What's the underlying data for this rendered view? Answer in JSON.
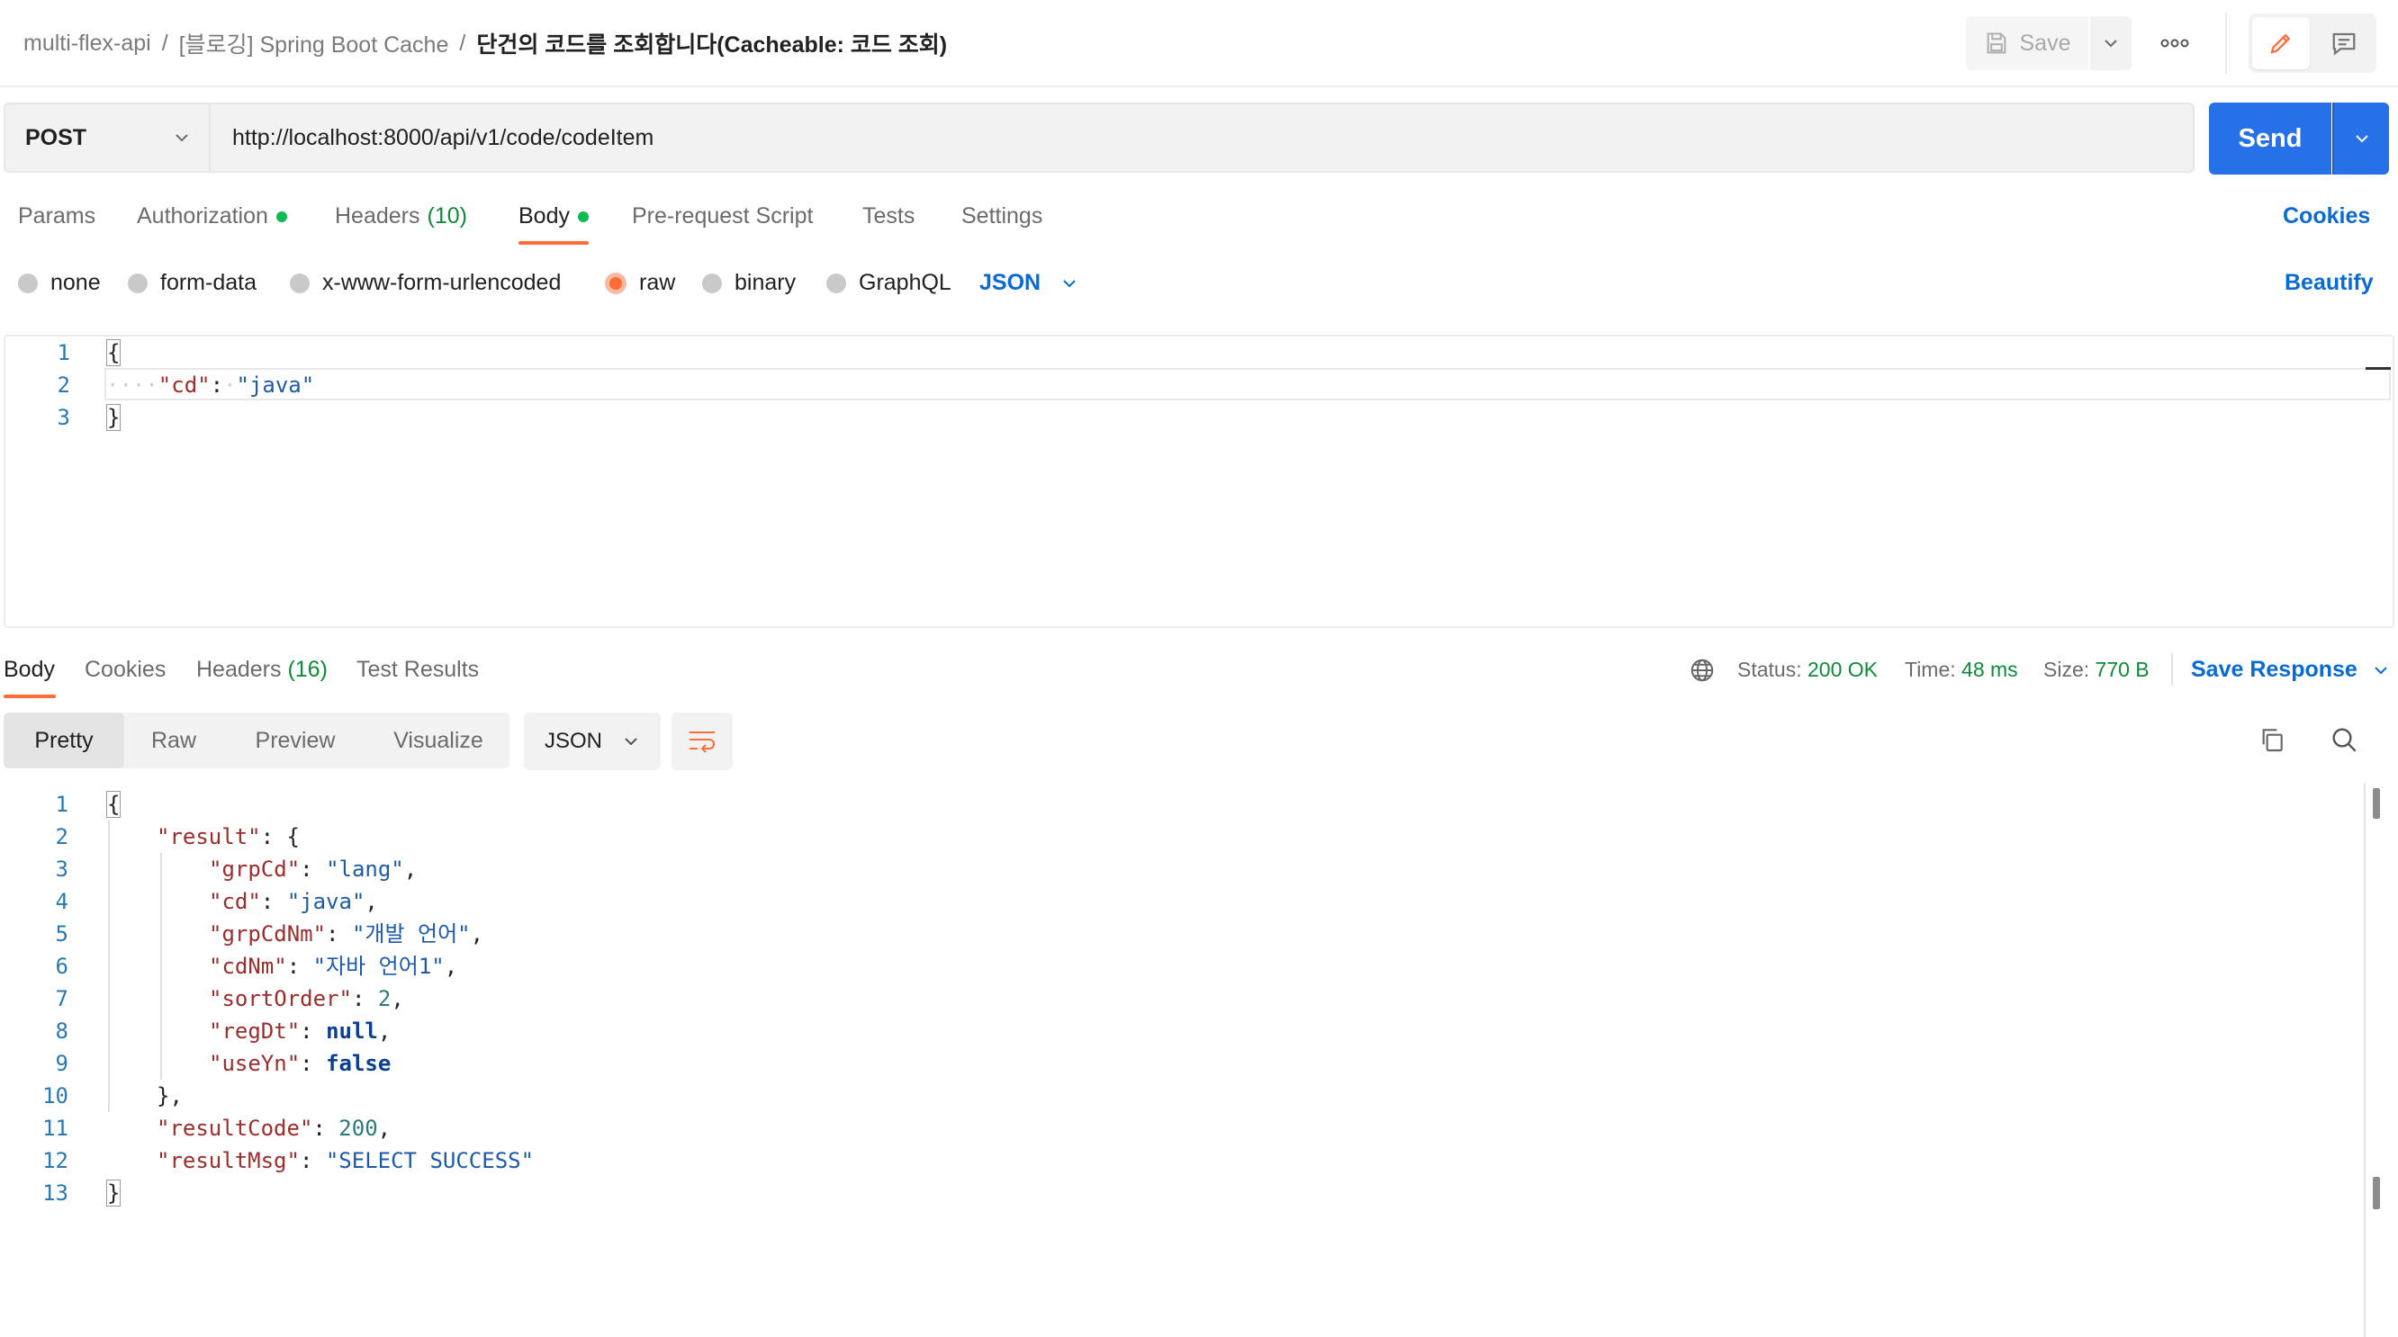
{
  "breadcrumb": {
    "workspace": "multi-flex-api",
    "collection": "[블로깅] Spring Boot Cache",
    "request": "단건의 코드를 조회합니다(Cacheable: 코드 조회)",
    "separator": "/"
  },
  "header": {
    "save_label": "Save"
  },
  "request": {
    "method": "POST",
    "url": "http://localhost:8000/api/v1/code/codeItem",
    "send_label": "Send"
  },
  "request_tabs": {
    "params": "Params",
    "authorization": "Authorization",
    "headers": "Headers",
    "headers_count": "(10)",
    "body": "Body",
    "prerequest": "Pre-request Script",
    "tests": "Tests",
    "settings": "Settings",
    "cookies": "Cookies"
  },
  "body_types": {
    "none": "none",
    "form_data": "form-data",
    "urlencoded": "x-www-form-urlencoded",
    "raw": "raw",
    "binary": "binary",
    "graphql": "GraphQL",
    "language": "JSON",
    "beautify": "Beautify",
    "selected": "raw"
  },
  "request_body": {
    "line_numbers": [
      "1",
      "2",
      "3"
    ],
    "open": "{",
    "indent": "····",
    "key": "\"cd\"",
    "colon": ":",
    "value": "\"java\"",
    "close": "}"
  },
  "response_tabs": {
    "body": "Body",
    "cookies": "Cookies",
    "headers": "Headers",
    "headers_count": "(16)",
    "test_results": "Test Results"
  },
  "response_status": {
    "status_label": "Status:",
    "status_value": "200 OK",
    "time_label": "Time:",
    "time_value": "48 ms",
    "size_label": "Size:",
    "size_value": "770 B",
    "save_response": "Save Response"
  },
  "response_view": {
    "pretty": "Pretty",
    "raw": "Raw",
    "preview": "Preview",
    "visualize": "Visualize",
    "format": "JSON"
  },
  "response_body": {
    "line_numbers": [
      "1",
      "2",
      "3",
      "4",
      "5",
      "6",
      "7",
      "8",
      "9",
      "10",
      "11",
      "12",
      "13"
    ],
    "l1": "{",
    "l2_key": "\"result\"",
    "l2_rest": ": {",
    "l3_key": "\"grpCd\"",
    "l3_val": "\"lang\"",
    "l4_key": "\"cd\"",
    "l4_val": "\"java\"",
    "l5_key": "\"grpCdNm\"",
    "l5_val": "\"개발 언어\"",
    "l6_key": "\"cdNm\"",
    "l6_val": "\"자바 언어1\"",
    "l7_key": "\"sortOrder\"",
    "l7_val": "2",
    "l8_key": "\"regDt\"",
    "l8_val": "null",
    "l9_key": "\"useYn\"",
    "l9_val": "false",
    "l10": "},",
    "l11_key": "\"resultCode\"",
    "l11_val": "200",
    "l12_key": "\"resultMsg\"",
    "l12_val": "\"SELECT SUCCESS\"",
    "l13": "}"
  },
  "colors": {
    "accent": "#ff6c37",
    "primary": "#2670e8",
    "link": "#0a6ad4",
    "success": "#0f8a3a",
    "json_key": "#9b2d2d",
    "json_string": "#1e5aa8"
  }
}
